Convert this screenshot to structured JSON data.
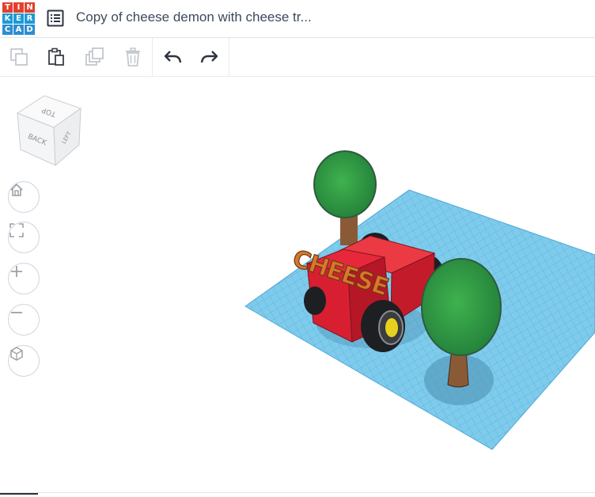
{
  "app": {
    "logo_letters": [
      "T",
      "I",
      "N",
      "K",
      "E",
      "R",
      "C",
      "A",
      "D"
    ],
    "logo_colors": [
      "#e2402d",
      "#e2402d",
      "#e2402d",
      "#1d9ad6",
      "#1d9ad6",
      "#1d9ad6",
      "#2b8ecf",
      "#2b8ecf",
      "#2b8ecf"
    ],
    "design_title": "Copy of cheese demon with cheese tr..."
  },
  "toolbar": {
    "buttons": [
      {
        "name": "copy-button",
        "icon": "copy-icon",
        "enabled": false
      },
      {
        "name": "paste-button",
        "icon": "paste-icon",
        "enabled": true
      },
      {
        "name": "duplicate-button",
        "icon": "duplicate-icon",
        "enabled": false
      },
      {
        "name": "delete-button",
        "icon": "trash-icon",
        "enabled": false
      },
      {
        "name": "undo-button",
        "icon": "undo-icon",
        "enabled": true
      },
      {
        "name": "redo-button",
        "icon": "redo-icon",
        "enabled": true
      }
    ]
  },
  "viewcube": {
    "top_label": "TOP",
    "front_label": "BACK",
    "side_label": "LEFT"
  },
  "nav_controls": [
    "home-icon",
    "fit-view-icon",
    "zoom-in-icon",
    "zoom-out-icon",
    "perspective-icon"
  ],
  "scene": {
    "model_text": "CHEESE",
    "colors": {
      "grid": "#7fcbec",
      "grid_lines": "#55b2dd",
      "car_body": "#e02032",
      "tree_leaves": "#2e9a3e",
      "trunk": "#8a5a37",
      "tire": "#1e1f22",
      "hub": "#e6d21c",
      "cheese_text": "#d9772a"
    }
  }
}
